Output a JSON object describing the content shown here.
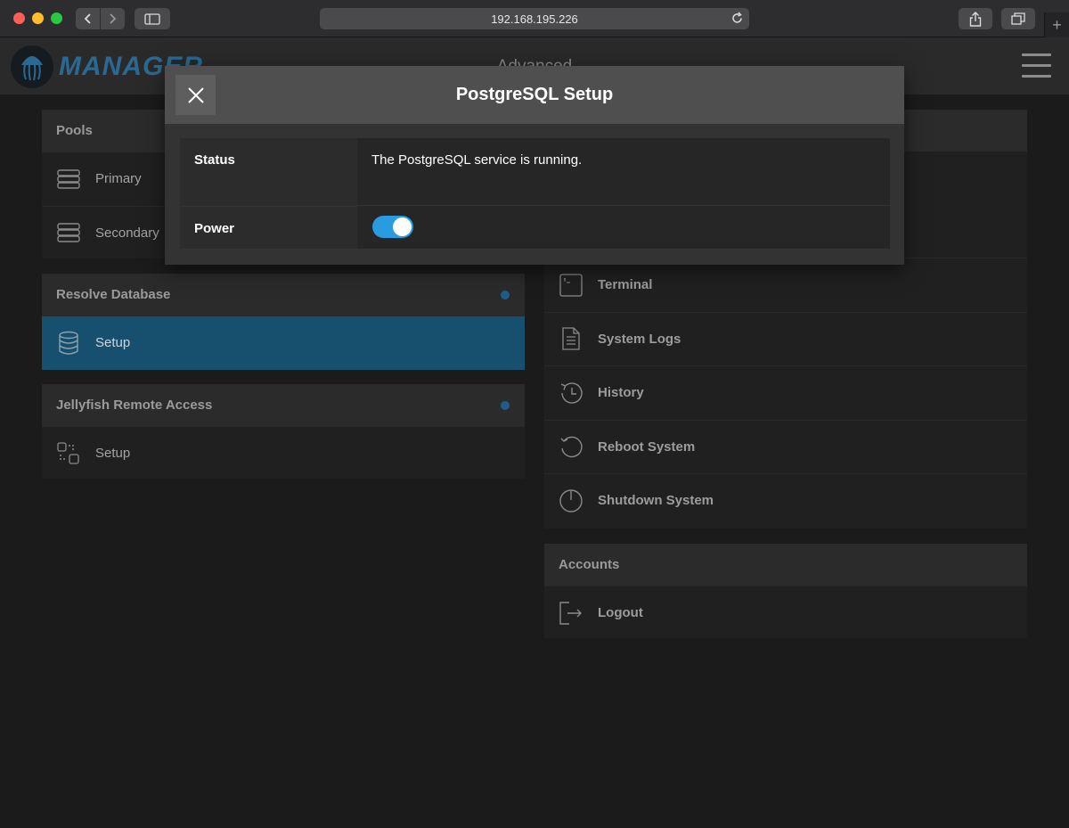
{
  "browser": {
    "url": "192.168.195.226",
    "new_tab_symbol": "+"
  },
  "app": {
    "logo_text": "MANAGER",
    "page_title": "Advanced"
  },
  "left_panels": [
    {
      "title": "Pools",
      "items": [
        {
          "label": "Primary",
          "icon": "server-stack-icon"
        },
        {
          "label": "Secondary",
          "icon": "server-stack-icon"
        }
      ]
    },
    {
      "title": "Resolve Database",
      "status_dot": true,
      "items": [
        {
          "label": "Setup",
          "icon": "database-icon",
          "active": true
        }
      ]
    },
    {
      "title": "Jellyfish Remote Access",
      "status_dot": true,
      "items": [
        {
          "label": "Setup",
          "icon": "network-nodes-icon"
        }
      ]
    }
  ],
  "right_panels": [
    {
      "title": "",
      "items": [
        {
          "label": "Terminal",
          "icon": "terminal-icon"
        },
        {
          "label": "System Logs",
          "icon": "document-icon"
        },
        {
          "label": "History",
          "icon": "history-clock-icon"
        },
        {
          "label": "Reboot System",
          "icon": "reboot-icon"
        },
        {
          "label": "Shutdown System",
          "icon": "power-icon"
        }
      ]
    },
    {
      "title": "Accounts",
      "items": [
        {
          "label": "Logout",
          "icon": "logout-icon"
        }
      ]
    }
  ],
  "modal": {
    "title": "PostgreSQL Setup",
    "status_label": "Status",
    "status_value": "The PostgreSQL service is running.",
    "power_label": "Power",
    "power_on": true
  },
  "colors": {
    "accent": "#2a9be0",
    "active_row": "#17506f",
    "status_dot": "#1d5f88",
    "logo": "#2a6a92"
  }
}
